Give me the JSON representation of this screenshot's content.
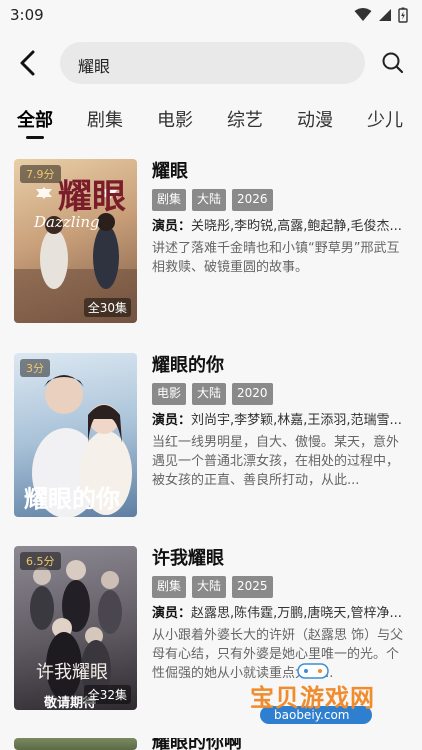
{
  "status": {
    "time": "3:09"
  },
  "search": {
    "query": "耀眼"
  },
  "tabs": [
    "全部",
    "剧集",
    "电影",
    "综艺",
    "动漫",
    "少儿"
  ],
  "results": [
    {
      "score": "7.9分",
      "title": "耀眼",
      "tags": [
        "剧集",
        "大陆",
        "2026"
      ],
      "cast_label": "演员：",
      "cast": "关晓彤,李昀锐,高露,鲍起静,毛俊杰...",
      "desc": "讲述了落难千金晴也和小镇“野草男”邢武互相救赎、破镜重圆的故事。",
      "episodes": "全30集",
      "poster_text": "耀眼",
      "poster_sub": "Dazzling",
      "poster_color": "#c9a07a"
    },
    {
      "score": "3分",
      "title": "耀眼的你",
      "tags": [
        "电影",
        "大陆",
        "2020"
      ],
      "cast_label": "演员：",
      "cast": "刘尚宇,李梦颖,林嘉,王添羽,范瑞雪...",
      "desc": "当红一线男明星，自大、傲慢。某天，意外遇见一个普通北漂女孩，在相处的过程中，被女孩的正直、善良所打动，从此...",
      "episodes": "",
      "poster_text": "耀眼的你",
      "poster_sub": "",
      "poster_color": "#9fb6cf"
    },
    {
      "score": "6.5分",
      "title": "许我耀眼",
      "tags": [
        "剧集",
        "大陆",
        "2025"
      ],
      "cast_label": "演员：",
      "cast": "赵露思,陈伟霆,万鹏,唐晓天,管梓净...",
      "desc": "从小跟着外婆长大的许妍（赵露思 饰）与父母有心结，只有外婆是她心里唯一的光。个性倔强的她从小就读重点大学...",
      "episodes": "全32集",
      "poster_text": "许我耀眼",
      "poster_sub": "敬请期待",
      "poster_color": "#6e6a72"
    },
    {
      "score": "",
      "title": "耀眼的你啊",
      "tags": [],
      "cast_label": "",
      "cast": "",
      "desc": "",
      "episodes": "",
      "poster_text": "",
      "poster_sub": "",
      "poster_color": "#5c6a48"
    }
  ],
  "watermark": {
    "name": "宝贝游戏网",
    "url": "baobeiy.com"
  },
  "colors": {
    "tag_bg": "#8a8a8a",
    "score": "#f2c76a",
    "search_bg": "#e9e9e9"
  }
}
